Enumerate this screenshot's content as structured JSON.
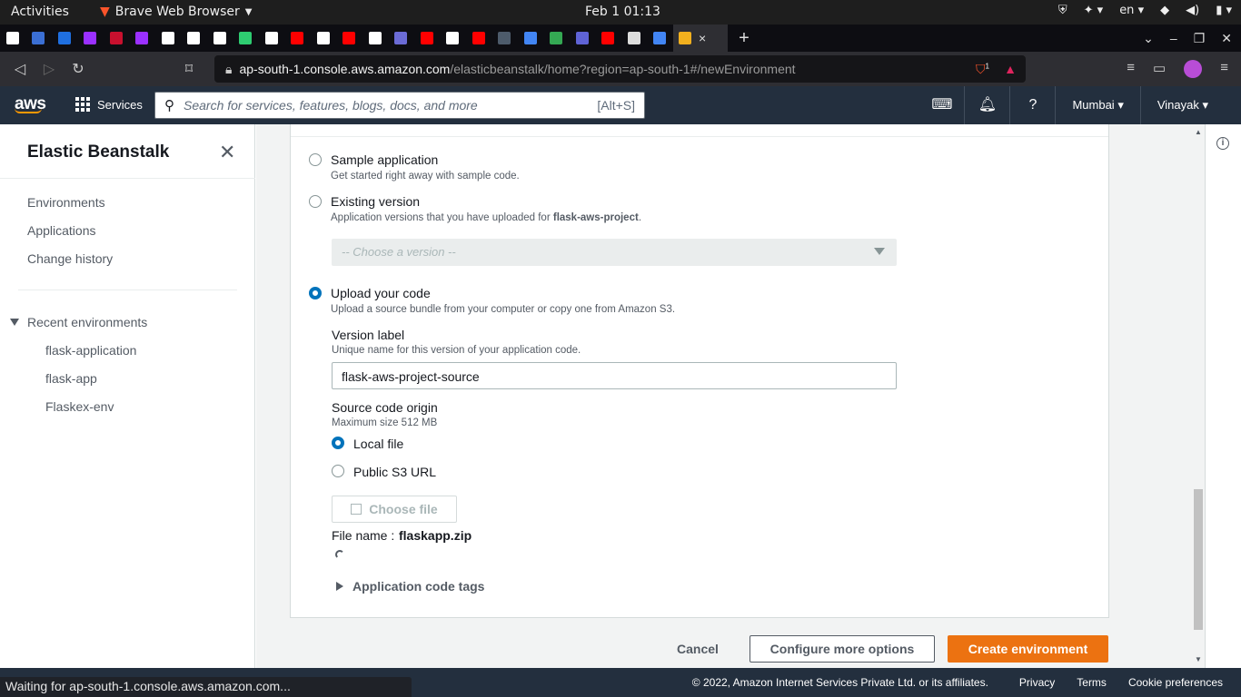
{
  "gnome": {
    "activities": "Activities",
    "app_name": "Brave Web Browser",
    "clock": "Feb 1  01:13",
    "lang": "en"
  },
  "tabs": {
    "favicon_colors": [
      "#ffffff",
      "#3b6fd4",
      "#1f6fe0",
      "#9b30ff",
      "#c8102e",
      "#9b30ff",
      "#ffffff",
      "#ffffff",
      "#ffffff",
      "#2ecc71",
      "#ffffff",
      "#ff0000",
      "#ffffff",
      "#ff0000",
      "#ffffff",
      "#6b6bd6",
      "#ff0000",
      "#ffffff",
      "#ff0000",
      "#4d5b6b",
      "#4285f4",
      "#34a853",
      "#5f63d6",
      "#ff0000",
      "#dddddd",
      "#4285f4"
    ],
    "active_close": "×",
    "new_tab": "+"
  },
  "address": {
    "host": "ap-south-1.console.aws.amazon.com",
    "path": "/elasticbeanstalk/home?region=ap-south-1#/newEnvironment",
    "brave_badge": "1"
  },
  "aws": {
    "logo": "aws",
    "services": "Services",
    "search_placeholder": "Search for services, features, blogs, docs, and more",
    "search_shortcut": "[Alt+S]",
    "region": "Mumbai",
    "user": "Vinayak"
  },
  "sidebar": {
    "title": "Elastic Beanstalk",
    "nav": [
      "Environments",
      "Applications",
      "Change history"
    ],
    "recent_title": "Recent environments",
    "recent": [
      "flask-application",
      "flask-app",
      "Flaskex-env"
    ]
  },
  "form": {
    "sample_label": "Sample application",
    "sample_desc": "Get started right away with sample code.",
    "existing_label": "Existing version",
    "existing_desc_prefix": "Application versions that you have uploaded for ",
    "existing_desc_app": "flask-aws-project",
    "existing_desc_suffix": ".",
    "version_select_placeholder": "-- Choose a version --",
    "upload_label": "Upload your code",
    "upload_desc": "Upload a source bundle from your computer or copy one from Amazon S3.",
    "version_label_title": "Version label",
    "version_label_desc": "Unique name for this version of your application code.",
    "version_label_value": "flask-aws-project-source",
    "origin_title": "Source code origin",
    "origin_desc": "Maximum size 512 MB",
    "local_file": "Local file",
    "s3_url": "Public S3 URL",
    "choose_file": "Choose file",
    "file_name_label": "File name :",
    "file_name_value": "flaskapp.zip",
    "tags": "Application code tags"
  },
  "actions": {
    "cancel": "Cancel",
    "configure": "Configure more options",
    "create": "Create environment"
  },
  "footer": {
    "copyright": "© 2022, Amazon Internet Services Private Ltd. or its affiliates.",
    "privacy": "Privacy",
    "terms": "Terms",
    "cookies": "Cookie preferences"
  },
  "status_bar": "Waiting for ap-south-1.console.aws.amazon.com...",
  "colors": {
    "aws_nav": "#232f3e",
    "primary_orange": "#ec7211",
    "radio_blue": "#0073bb"
  }
}
